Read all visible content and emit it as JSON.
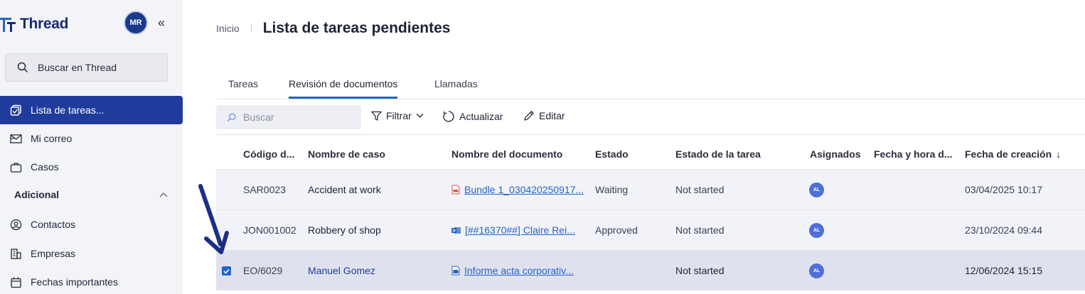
{
  "app": {
    "name": "Thread",
    "user_initials": "MR",
    "collapse_glyph": "«"
  },
  "sidebar": {
    "search_placeholder": "Buscar en Thread",
    "items": [
      {
        "label": "Lista de tareas...",
        "icon": "task-list-icon",
        "active": true
      },
      {
        "label": "Mi correo",
        "icon": "mail-icon"
      },
      {
        "label": "Casos",
        "icon": "briefcase-icon"
      }
    ],
    "section": {
      "label": "Adicional",
      "expanded": true
    },
    "section_items": [
      {
        "label": "Contactos",
        "icon": "contact-icon"
      },
      {
        "label": "Empresas",
        "icon": "building-icon"
      },
      {
        "label": "Fechas importantes",
        "icon": "calendar-icon"
      }
    ]
  },
  "header": {
    "breadcrumb": "Inicio",
    "title": "Lista de tareas pendientes"
  },
  "tabs": [
    {
      "label": "Tareas"
    },
    {
      "label": "Revisión de documentos",
      "active": true
    },
    {
      "label": "Llamadas"
    }
  ],
  "toolbar": {
    "search_placeholder": "Buscar",
    "filter_label": "Filtrar",
    "refresh_label": "Actualizar",
    "edit_label": "Editar"
  },
  "table": {
    "columns": [
      "Código d...",
      "Nombre de caso",
      "Nombre del documento",
      "Estado",
      "Estado de la tarea",
      "Asignados",
      "Fecha y hora d...",
      "Fecha de creación"
    ],
    "sort_indicator": "↓",
    "rows": [
      {
        "code": "SAR0023",
        "case": "Accident at work",
        "document": "Bundle 1_030420250917...",
        "doc_icon": "pdf-icon",
        "status": "Waiting",
        "task_status": "Not started",
        "assignee": "AL",
        "datetime": "",
        "created": "03/04/2025 10:17",
        "selected": false
      },
      {
        "code": "JON001002",
        "case": "Robbery of shop",
        "document": "[##16370##] Claire Rei...",
        "doc_icon": "outlook-icon",
        "status": "Approved",
        "task_status": "Not started",
        "assignee": "AL",
        "datetime": "",
        "created": "23/10/2024 09:44",
        "selected": false
      },
      {
        "code": "EO/6029",
        "case": "Manuel Gomez",
        "document": "Informe acta corporativ...",
        "doc_icon": "word-icon",
        "status": "",
        "task_status": "Not started",
        "assignee": "AL",
        "datetime": "",
        "created": "12/06/2024 15:15",
        "selected": true
      }
    ]
  },
  "colors": {
    "brand": "#1c2a6b",
    "active_nav": "#1f3c9d",
    "link": "#2563c9",
    "badge": "#4e6fd8",
    "annotation_arrow": "#1c2f86"
  }
}
